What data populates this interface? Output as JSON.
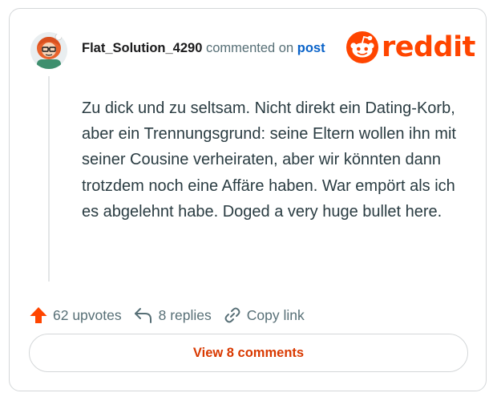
{
  "header": {
    "username": "Flat_Solution_4290",
    "action_text": "commented on",
    "post_link": "post"
  },
  "brand": {
    "wordmark": "reddit",
    "icon": "reddit-snoo-icon",
    "color": "#ff4500"
  },
  "avatar": {
    "icon": "user-avatar-icon"
  },
  "comment": {
    "text": "Zu dick und zu seltsam. Nicht direkt ein Dating-Korb, aber ein Trennungsgrund: seine Eltern wollen ihn mit seiner Cousine verheiraten, aber wir könnten dann trotzdem noch eine Affäre haben. War empört als ich es abgelehnt habe. Doged a very huge bullet here."
  },
  "actions": {
    "upvotes_label": "62 upvotes",
    "replies_label": "8 replies",
    "copy_label": "Copy link",
    "upvote_icon": "upvote-arrow-icon",
    "reply_icon": "reply-arrow-icon",
    "link_icon": "chain-link-icon",
    "upvote_color": "#ff4500"
  },
  "view_button": {
    "label": "View 8 comments",
    "color": "#d93900"
  }
}
